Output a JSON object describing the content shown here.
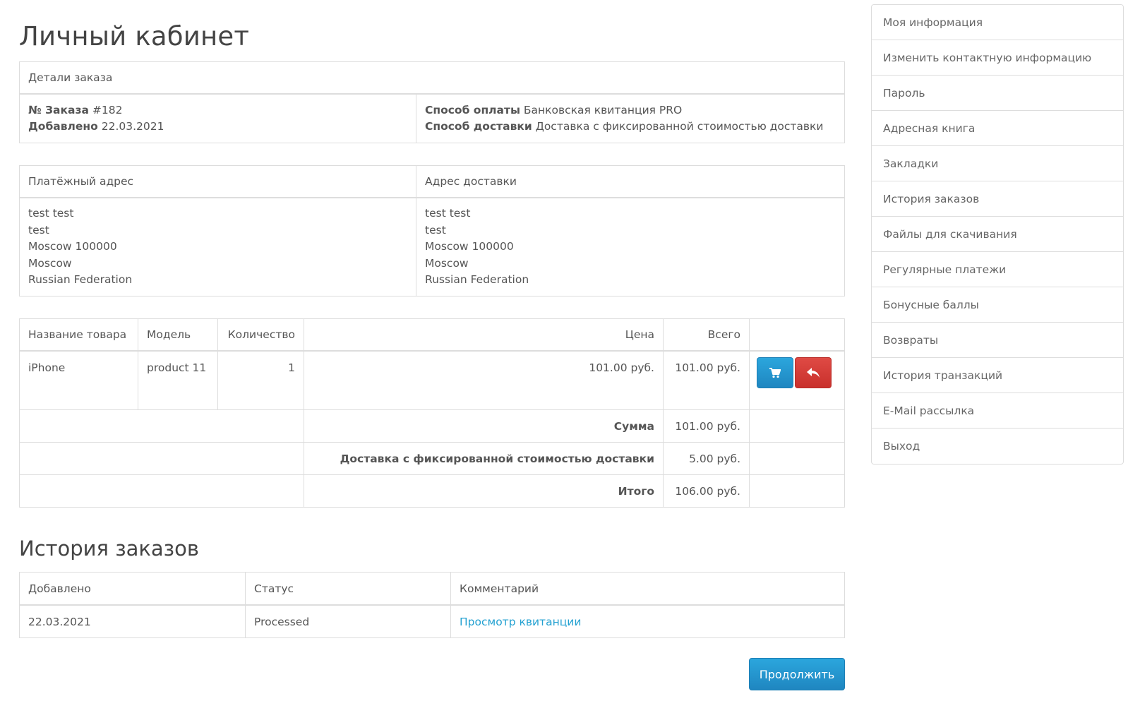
{
  "page_title": "Личный кабинет",
  "order_details": {
    "header": "Детали заказа",
    "order_no_label": "№ Заказа",
    "order_no_value": "#182",
    "added_label": "Добавлено",
    "added_value": "22.03.2021",
    "payment_label": "Способ оплаты",
    "payment_value": "Банковская квитанция PRO",
    "shipping_label": "Способ доставки",
    "shipping_value": "Доставка с фиксированной стоимостью доставки"
  },
  "addresses": {
    "payment_header": "Платёжный адрес",
    "shipping_header": "Адрес доставки",
    "payment_lines": [
      "test test",
      "test",
      "Moscow 100000",
      "Moscow",
      "Russian Federation"
    ],
    "shipping_lines": [
      "test test",
      "test",
      "Moscow 100000",
      "Moscow",
      "Russian Federation"
    ]
  },
  "products": {
    "headers": {
      "name": "Название товара",
      "model": "Модель",
      "qty": "Количество",
      "price": "Цена",
      "total": "Всего"
    },
    "items": [
      {
        "name": "iPhone",
        "model": "product 11",
        "qty": "1",
        "price": "101.00 руб.",
        "total": "101.00 руб."
      }
    ],
    "totals": [
      {
        "label": "Сумма",
        "value": "101.00 руб."
      },
      {
        "label": "Доставка с фиксированной стоимостью доставки",
        "value": "5.00 руб."
      },
      {
        "label": "Итого",
        "value": "106.00 руб."
      }
    ],
    "reorder_icon": "shopping-cart-icon",
    "return_icon": "reply-icon",
    "colors": {
      "reorder": "#2297d2",
      "return": "#d9403b"
    }
  },
  "history": {
    "title": "История заказов",
    "headers": {
      "date": "Добавлено",
      "status": "Статус",
      "comment": "Комментарий"
    },
    "rows": [
      {
        "date": "22.03.2021",
        "status": "Processed",
        "comment": "Просмотр квитанции"
      }
    ]
  },
  "continue_label": "Продолжить",
  "sidebar": {
    "items": [
      "Моя информация",
      "Изменить контактную информацию",
      "Пароль",
      "Адресная книга",
      "Закладки",
      "История заказов",
      "Файлы для скачивания",
      "Регулярные платежи",
      "Бонусные баллы",
      "Возвраты",
      "История транзакций",
      "E-Mail рассылка",
      "Выход"
    ]
  }
}
